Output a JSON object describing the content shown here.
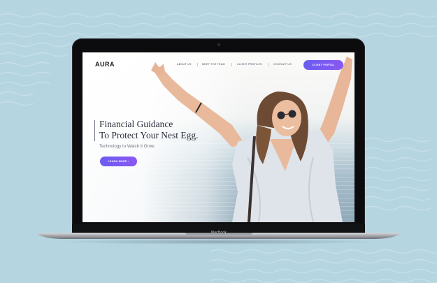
{
  "site": {
    "logo": "AURA"
  },
  "nav": {
    "links": [
      "ABOUT US",
      "MEET THE TEAM",
      "CLIENT PROFILES",
      "CONTACT US"
    ],
    "cta": "CLIENT PORTAL"
  },
  "hero": {
    "headline_line1": "Financial Guidance",
    "headline_line2": "To Protect Your Nest Egg.",
    "subheadline": "Technology to Watch it Grow.",
    "button": "LEARN MORE ›"
  },
  "device": {
    "brand": "MacBook"
  },
  "colors": {
    "background": "#b5d5e1",
    "accent_start": "#6a5cf0",
    "accent_end": "#8b57f3"
  }
}
